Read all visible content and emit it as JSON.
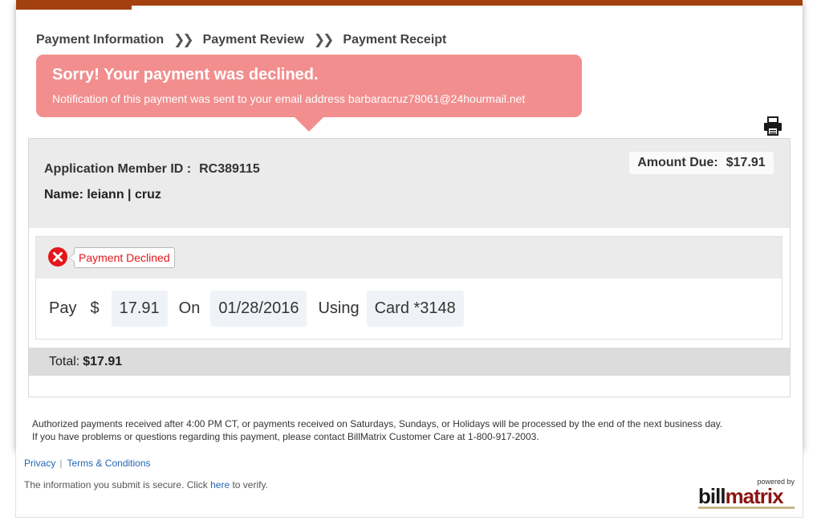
{
  "steps": [
    {
      "label": "Payment Information"
    },
    {
      "label": "Payment Review"
    },
    {
      "label": "Payment Receipt"
    }
  ],
  "step_separator": "❯❯",
  "alert": {
    "title": "Sorry! Your payment was declined.",
    "message": "Notification of this payment was sent to your email address barbaracruz78061@24hourmail.net"
  },
  "account": {
    "member_label": "Application Member ID :",
    "member_id": "RC389115",
    "name_label": "Name:",
    "name_value": "leiann | cruz",
    "amount_label": "Amount Due:",
    "amount_value": "$17.91"
  },
  "status": {
    "label": "Payment Declined",
    "icon": "x-circle-icon",
    "color": "#e3161b"
  },
  "payment": {
    "pay_word": "Pay",
    "currency": "$",
    "amount": "17.91",
    "on_word": "On",
    "date": "01/28/2016",
    "using_word": "Using",
    "method": "Card *3148"
  },
  "total": {
    "label": "Total:",
    "value": "$17.91"
  },
  "notice": {
    "line1": "Authorized payments received after 4:00 PM CT, or payments received on Saturdays, Sundays, or Holidays will be processed by the end of the next business day.",
    "line2": "If you have problems or questions regarding this payment, please contact BillMatrix Customer Care at 1-800-917-2003."
  },
  "footer": {
    "privacy": "Privacy",
    "pipe": "|",
    "terms": "Terms & Conditions",
    "secure_prefix": "The information you submit is secure. Click ",
    "secure_link": "here",
    "secure_suffix": " to verify."
  },
  "logo": {
    "powered_by": "powered by",
    "bill": "bill",
    "matrix": "matrix"
  },
  "colors": {
    "brand_bar": "#a3400f",
    "alert_bg": "#f28e8e",
    "link": "#2367b5",
    "declined": "#e3161b"
  }
}
